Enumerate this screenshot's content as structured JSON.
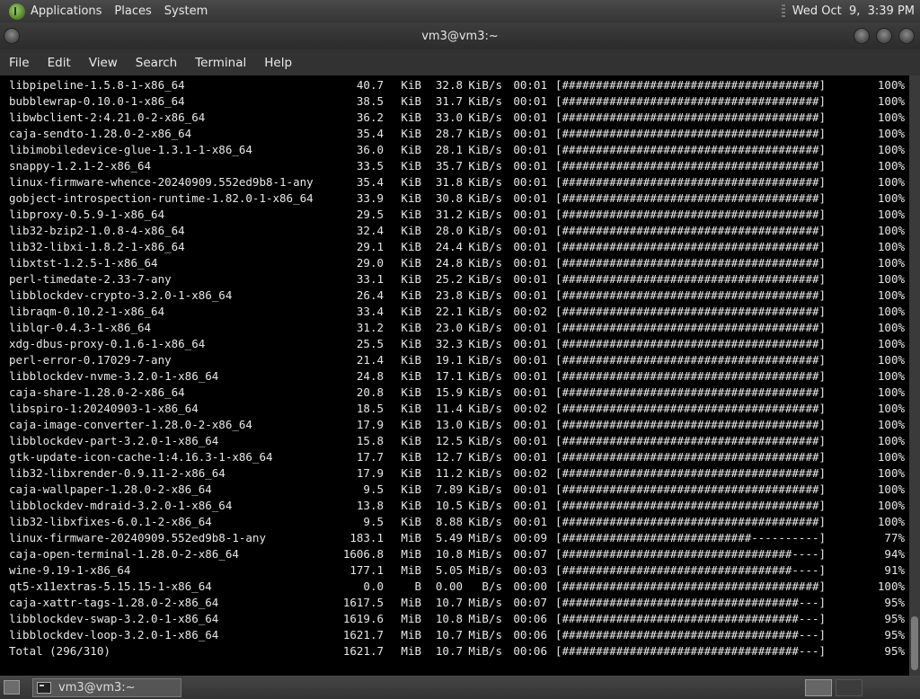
{
  "top_panel": {
    "menus": [
      "Applications",
      "Places",
      "System"
    ],
    "clock": "Wed Oct  9,  3:39 PM"
  },
  "window": {
    "title": "vm3@vm3:~"
  },
  "menubar": [
    "File",
    "Edit",
    "View",
    "Search",
    "Terminal",
    "Help"
  ],
  "rows": [
    {
      "name": "libpipeline-1.5.8-1-x86_64",
      "size": "40.7",
      "unit": "KiB",
      "rate": "32.8",
      "runit": "KiB/s",
      "time": "00:01",
      "bar": "[######################################]",
      "pct": "100%"
    },
    {
      "name": "bubblewrap-0.10.0-1-x86_64",
      "size": "38.5",
      "unit": "KiB",
      "rate": "31.7",
      "runit": "KiB/s",
      "time": "00:01",
      "bar": "[######################################]",
      "pct": "100%"
    },
    {
      "name": "libwbclient-2:4.21.0-2-x86_64",
      "size": "36.2",
      "unit": "KiB",
      "rate": "33.0",
      "runit": "KiB/s",
      "time": "00:01",
      "bar": "[######################################]",
      "pct": "100%"
    },
    {
      "name": "caja-sendto-1.28.0-2-x86_64",
      "size": "35.4",
      "unit": "KiB",
      "rate": "28.7",
      "runit": "KiB/s",
      "time": "00:01",
      "bar": "[######################################]",
      "pct": "100%"
    },
    {
      "name": "libimobiledevice-glue-1.3.1-1-x86_64",
      "size": "36.0",
      "unit": "KiB",
      "rate": "28.1",
      "runit": "KiB/s",
      "time": "00:01",
      "bar": "[######################################]",
      "pct": "100%"
    },
    {
      "name": "snappy-1.2.1-2-x86_64",
      "size": "33.5",
      "unit": "KiB",
      "rate": "35.7",
      "runit": "KiB/s",
      "time": "00:01",
      "bar": "[######################################]",
      "pct": "100%"
    },
    {
      "name": "linux-firmware-whence-20240909.552ed9b8-1-any",
      "size": "35.4",
      "unit": "KiB",
      "rate": "31.8",
      "runit": "KiB/s",
      "time": "00:01",
      "bar": "[######################################]",
      "pct": "100%"
    },
    {
      "name": "gobject-introspection-runtime-1.82.0-1-x86_64",
      "size": "33.9",
      "unit": "KiB",
      "rate": "30.8",
      "runit": "KiB/s",
      "time": "00:01",
      "bar": "[######################################]",
      "pct": "100%"
    },
    {
      "name": "libproxy-0.5.9-1-x86_64",
      "size": "29.5",
      "unit": "KiB",
      "rate": "31.2",
      "runit": "KiB/s",
      "time": "00:01",
      "bar": "[######################################]",
      "pct": "100%"
    },
    {
      "name": "lib32-bzip2-1.0.8-4-x86_64",
      "size": "32.4",
      "unit": "KiB",
      "rate": "28.0",
      "runit": "KiB/s",
      "time": "00:01",
      "bar": "[######################################]",
      "pct": "100%"
    },
    {
      "name": "lib32-libxi-1.8.2-1-x86_64",
      "size": "29.1",
      "unit": "KiB",
      "rate": "24.4",
      "runit": "KiB/s",
      "time": "00:01",
      "bar": "[######################################]",
      "pct": "100%"
    },
    {
      "name": "libxtst-1.2.5-1-x86_64",
      "size": "29.0",
      "unit": "KiB",
      "rate": "24.8",
      "runit": "KiB/s",
      "time": "00:01",
      "bar": "[######################################]",
      "pct": "100%"
    },
    {
      "name": "perl-timedate-2.33-7-any",
      "size": "33.1",
      "unit": "KiB",
      "rate": "25.2",
      "runit": "KiB/s",
      "time": "00:01",
      "bar": "[######################################]",
      "pct": "100%"
    },
    {
      "name": "libblockdev-crypto-3.2.0-1-x86_64",
      "size": "26.4",
      "unit": "KiB",
      "rate": "23.8",
      "runit": "KiB/s",
      "time": "00:01",
      "bar": "[######################################]",
      "pct": "100%"
    },
    {
      "name": "libraqm-0.10.2-1-x86_64",
      "size": "33.4",
      "unit": "KiB",
      "rate": "22.1",
      "runit": "KiB/s",
      "time": "00:02",
      "bar": "[######################################]",
      "pct": "100%"
    },
    {
      "name": "liblqr-0.4.3-1-x86_64",
      "size": "31.2",
      "unit": "KiB",
      "rate": "23.0",
      "runit": "KiB/s",
      "time": "00:01",
      "bar": "[######################################]",
      "pct": "100%"
    },
    {
      "name": "xdg-dbus-proxy-0.1.6-1-x86_64",
      "size": "25.5",
      "unit": "KiB",
      "rate": "32.3",
      "runit": "KiB/s",
      "time": "00:01",
      "bar": "[######################################]",
      "pct": "100%"
    },
    {
      "name": "perl-error-0.17029-7-any",
      "size": "21.4",
      "unit": "KiB",
      "rate": "19.1",
      "runit": "KiB/s",
      "time": "00:01",
      "bar": "[######################################]",
      "pct": "100%"
    },
    {
      "name": "libblockdev-nvme-3.2.0-1-x86_64",
      "size": "24.8",
      "unit": "KiB",
      "rate": "17.1",
      "runit": "KiB/s",
      "time": "00:01",
      "bar": "[######################################]",
      "pct": "100%"
    },
    {
      "name": "caja-share-1.28.0-2-x86_64",
      "size": "20.8",
      "unit": "KiB",
      "rate": "15.9",
      "runit": "KiB/s",
      "time": "00:01",
      "bar": "[######################################]",
      "pct": "100%"
    },
    {
      "name": "libspiro-1:20240903-1-x86_64",
      "size": "18.5",
      "unit": "KiB",
      "rate": "11.4",
      "runit": "KiB/s",
      "time": "00:02",
      "bar": "[######################################]",
      "pct": "100%"
    },
    {
      "name": "caja-image-converter-1.28.0-2-x86_64",
      "size": "17.9",
      "unit": "KiB",
      "rate": "13.0",
      "runit": "KiB/s",
      "time": "00:01",
      "bar": "[######################################]",
      "pct": "100%"
    },
    {
      "name": "libblockdev-part-3.2.0-1-x86_64",
      "size": "15.8",
      "unit": "KiB",
      "rate": "12.5",
      "runit": "KiB/s",
      "time": "00:01",
      "bar": "[######################################]",
      "pct": "100%"
    },
    {
      "name": "gtk-update-icon-cache-1:4.16.3-1-x86_64",
      "size": "17.7",
      "unit": "KiB",
      "rate": "12.7",
      "runit": "KiB/s",
      "time": "00:01",
      "bar": "[######################################]",
      "pct": "100%"
    },
    {
      "name": "lib32-libxrender-0.9.11-2-x86_64",
      "size": "17.9",
      "unit": "KiB",
      "rate": "11.2",
      "runit": "KiB/s",
      "time": "00:02",
      "bar": "[######################################]",
      "pct": "100%"
    },
    {
      "name": "caja-wallpaper-1.28.0-2-x86_64",
      "size": "9.5",
      "unit": "KiB",
      "rate": "7.89",
      "runit": "KiB/s",
      "time": "00:01",
      "bar": "[######################################]",
      "pct": "100%"
    },
    {
      "name": "libblockdev-mdraid-3.2.0-1-x86_64",
      "size": "13.8",
      "unit": "KiB",
      "rate": "10.5",
      "runit": "KiB/s",
      "time": "00:01",
      "bar": "[######################################]",
      "pct": "100%"
    },
    {
      "name": "lib32-libxfixes-6.0.1-2-x86_64",
      "size": "9.5",
      "unit": "KiB",
      "rate": "8.88",
      "runit": "KiB/s",
      "time": "00:01",
      "bar": "[######################################]",
      "pct": "100%"
    },
    {
      "name": "linux-firmware-20240909.552ed9b8-1-any",
      "size": "183.1",
      "unit": "MiB",
      "rate": "5.49",
      "runit": "MiB/s",
      "time": "00:09",
      "bar": "[############################----------]",
      "pct": "77%"
    },
    {
      "name": "caja-open-terminal-1.28.0-2-x86_64",
      "size": "1606.8",
      "unit": "MiB",
      "rate": "10.8",
      "runit": "MiB/s",
      "time": "00:07",
      "bar": "[##################################----]",
      "pct": "94%"
    },
    {
      "name": "wine-9.19-1-x86_64",
      "size": "177.1",
      "unit": "MiB",
      "rate": "5.05",
      "runit": "MiB/s",
      "time": "00:03",
      "bar": "[##################################----]",
      "pct": "91%"
    },
    {
      "name": "qt5-x11extras-5.15.15-1-x86_64",
      "size": "0.0",
      "unit": "B",
      "rate": "0.00",
      "runit": "B/s",
      "time": "00:00",
      "bar": "[######################################]",
      "pct": "100%"
    },
    {
      "name": "caja-xattr-tags-1.28.0-2-x86_64",
      "size": "1617.5",
      "unit": "MiB",
      "rate": "10.7",
      "runit": "MiB/s",
      "time": "00:07",
      "bar": "[###################################---]",
      "pct": "95%"
    },
    {
      "name": "libblockdev-swap-3.2.0-1-x86_64",
      "size": "1619.6",
      "unit": "MiB",
      "rate": "10.8",
      "runit": "MiB/s",
      "time": "00:06",
      "bar": "[###################################---]",
      "pct": "95%"
    },
    {
      "name": "libblockdev-loop-3.2.0-1-x86_64",
      "size": "1621.7",
      "unit": "MiB",
      "rate": "10.7",
      "runit": "MiB/s",
      "time": "00:06",
      "bar": "[###################################---]",
      "pct": "95%"
    },
    {
      "name": "Total (296/310)",
      "size": "1621.7",
      "unit": "MiB",
      "rate": "10.7",
      "runit": "MiB/s",
      "time": "00:06",
      "bar": "[###################################---]",
      "pct": "95%"
    }
  ],
  "taskbar": {
    "task_label": "vm3@vm3:~"
  }
}
